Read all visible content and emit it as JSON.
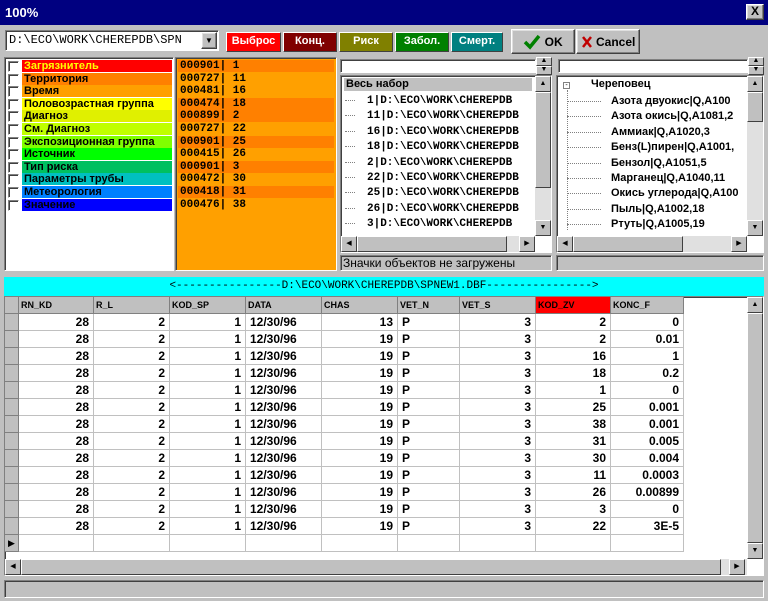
{
  "window": {
    "title": "100%",
    "close_label": "X"
  },
  "toolbar": {
    "path": "D:\\ECO\\WORK\\CHEREPDB\\SPN",
    "buttons": [
      {
        "label": "Выброс",
        "bg": "#ff0000",
        "fg": "#ffffff"
      },
      {
        "label": "Конц.",
        "bg": "#800000",
        "fg": "#ffffff"
      },
      {
        "label": "Риск",
        "bg": "#808000",
        "fg": "#ffffff"
      },
      {
        "label": "Забол.",
        "bg": "#008000",
        "fg": "#ffffff"
      },
      {
        "label": "Смерт.",
        "bg": "#008080",
        "fg": "#ffffff"
      }
    ],
    "ok_label": "OK",
    "cancel_label": "Cancel"
  },
  "categories": [
    {
      "label": "Загрязнитель",
      "bg": "#ff0000",
      "fg": "#ffff00"
    },
    {
      "label": "Территория",
      "bg": "#ff8000",
      "fg": "#000000"
    },
    {
      "label": "Время",
      "bg": "#ffa000",
      "fg": "#000000"
    },
    {
      "label": "Половозрастная группа",
      "bg": "#ffff00",
      "fg": "#000000"
    },
    {
      "label": "Диагноз",
      "bg": "#e0f000",
      "fg": "#000000"
    },
    {
      "label": "См. Диагноз",
      "bg": "#c0ff00",
      "fg": "#000000"
    },
    {
      "label": "Экспозиционная группа",
      "bg": "#80ff00",
      "fg": "#000000"
    },
    {
      "label": "Источник",
      "bg": "#00ff00",
      "fg": "#000000"
    },
    {
      "label": "Тип риска",
      "bg": "#00c060",
      "fg": "#000000"
    },
    {
      "label": "Параметры трубы",
      "bg": "#00c0c0",
      "fg": "#000000"
    },
    {
      "label": "Метеорология",
      "bg": "#0080ff",
      "fg": "#000000"
    },
    {
      "label": "Значение",
      "bg": "#0000ff",
      "fg": "#000000"
    }
  ],
  "codes": [
    {
      "label": "000901| 1",
      "bg": "#ff8000"
    },
    {
      "label": "000727| 11",
      "bg": "#ffa000"
    },
    {
      "label": "000481| 16",
      "bg": "#ffa000"
    },
    {
      "label": "000474| 18",
      "bg": "#ff8000"
    },
    {
      "label": "000899| 2",
      "bg": "#ff8000"
    },
    {
      "label": "000727| 22",
      "bg": "#ffa000"
    },
    {
      "label": "000901| 25",
      "bg": "#ff8000"
    },
    {
      "label": "000415| 26",
      "bg": "#ffa000"
    },
    {
      "label": "000901| 3",
      "bg": "#ff8000"
    },
    {
      "label": "000472| 30",
      "bg": "#ffa000"
    },
    {
      "label": "000418| 31",
      "bg": "#ff8000"
    },
    {
      "label": "000476| 38",
      "bg": "#ffa000"
    }
  ],
  "dataset": {
    "header": "Весь набор",
    "items": [
      "1|D:\\ECO\\WORK\\CHEREPDB",
      "11|D:\\ECO\\WORK\\CHEREPDB",
      "16|D:\\ECO\\WORK\\CHEREPDB",
      "18|D:\\ECO\\WORK\\CHEREPDB",
      "2|D:\\ECO\\WORK\\CHEREPDB",
      "22|D:\\ECO\\WORK\\CHEREPDB",
      "25|D:\\ECO\\WORK\\CHEREPDB",
      "26|D:\\ECO\\WORK\\CHEREPDB",
      "3|D:\\ECO\\WORK\\CHEREPDB"
    ],
    "status": "Значки объектов не загружены"
  },
  "tree": {
    "root": "Череповец",
    "items": [
      "Азота двуокис|Q,A100",
      "Азота окись|Q,A1081,2",
      "Аммиак|Q,A1020,3",
      "Бенз(L)пирен|Q,A1001,",
      "Бензол|Q,A1051,5",
      "Марганец|Q,A1040,11",
      "Окись углерода|Q,A100",
      "Пыль|Q,A1002,18",
      "Ртуть|Q,A1005,19"
    ]
  },
  "grid": {
    "title": "<----------------D:\\ECO\\WORK\\CHEREPDB\\SPNEW1.DBF---------------->",
    "highlight_color": "#ff0000",
    "columns": [
      "RN_KD",
      "R_L",
      "KOD_SP",
      "DATA",
      "CHAS",
      "VET_N",
      "VET_S",
      "KOD_ZV",
      "KONC_F"
    ],
    "rows": [
      [
        "28",
        "2",
        "1",
        "12/30/96",
        "13",
        "P",
        "3",
        "2",
        "0"
      ],
      [
        "28",
        "2",
        "1",
        "12/30/96",
        "19",
        "P",
        "3",
        "2",
        "0.01"
      ],
      [
        "28",
        "2",
        "1",
        "12/30/96",
        "19",
        "P",
        "3",
        "16",
        "1"
      ],
      [
        "28",
        "2",
        "1",
        "12/30/96",
        "19",
        "P",
        "3",
        "18",
        "0.2"
      ],
      [
        "28",
        "2",
        "1",
        "12/30/96",
        "19",
        "P",
        "3",
        "1",
        "0"
      ],
      [
        "28",
        "2",
        "1",
        "12/30/96",
        "19",
        "P",
        "3",
        "25",
        "0.001"
      ],
      [
        "28",
        "2",
        "1",
        "12/30/96",
        "19",
        "P",
        "3",
        "38",
        "0.001"
      ],
      [
        "28",
        "2",
        "1",
        "12/30/96",
        "19",
        "P",
        "3",
        "31",
        "0.005"
      ],
      [
        "28",
        "2",
        "1",
        "12/30/96",
        "19",
        "P",
        "3",
        "30",
        "0.004"
      ],
      [
        "28",
        "2",
        "1",
        "12/30/96",
        "19",
        "P",
        "3",
        "11",
        "0.0003"
      ],
      [
        "28",
        "2",
        "1",
        "12/30/96",
        "19",
        "P",
        "3",
        "26",
        "0.00899"
      ],
      [
        "28",
        "2",
        "1",
        "12/30/96",
        "19",
        "P",
        "3",
        "3",
        "0"
      ],
      [
        "28",
        "2",
        "1",
        "12/30/96",
        "19",
        "P",
        "3",
        "22",
        "3E-5"
      ]
    ]
  }
}
